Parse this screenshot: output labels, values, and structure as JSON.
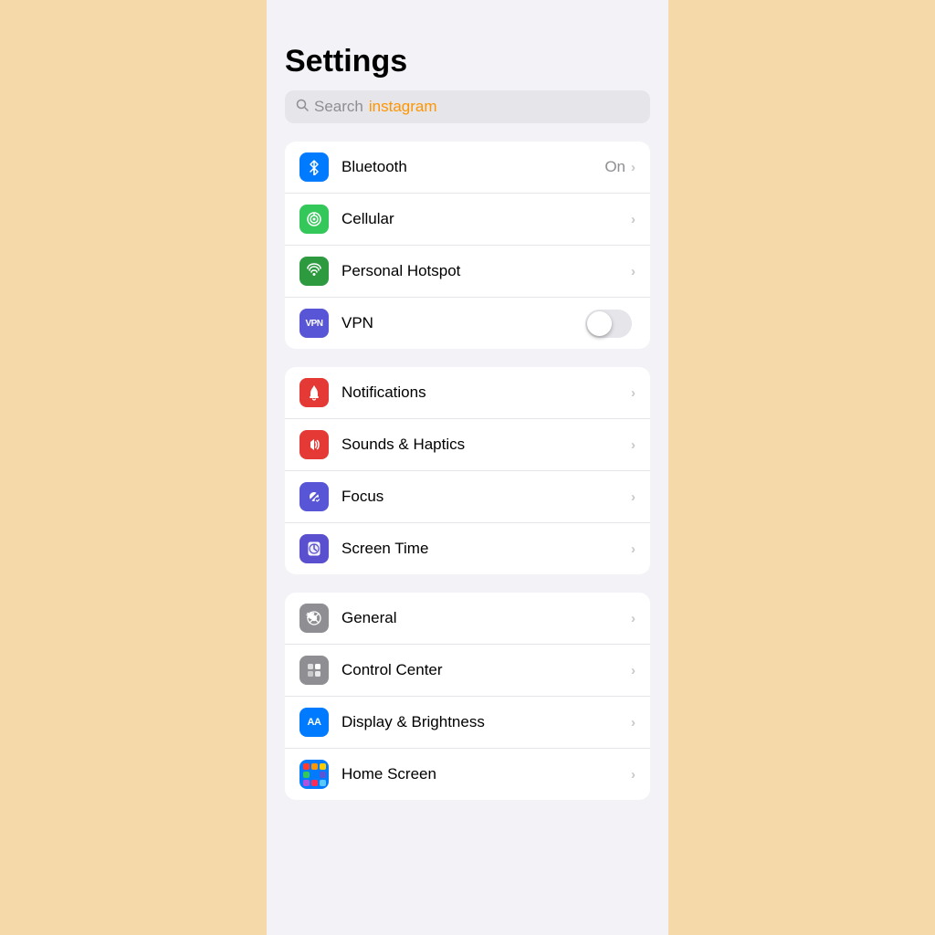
{
  "page": {
    "title": "Settings",
    "background": "#f5d9a8"
  },
  "search": {
    "placeholder": "Search",
    "query": "instagram"
  },
  "groups": [
    {
      "id": "connectivity",
      "items": [
        {
          "id": "bluetooth",
          "label": "Bluetooth",
          "value": "On",
          "icon": "bluetooth",
          "iconBg": "blue",
          "hasChevron": true,
          "hasToggle": false
        },
        {
          "id": "cellular",
          "label": "Cellular",
          "value": "",
          "icon": "cellular",
          "iconBg": "green",
          "hasChevron": true,
          "hasToggle": false
        },
        {
          "id": "personal-hotspot",
          "label": "Personal Hotspot",
          "value": "",
          "icon": "hotspot",
          "iconBg": "dark-green",
          "hasChevron": true,
          "hasToggle": false
        },
        {
          "id": "vpn",
          "label": "VPN",
          "value": "",
          "icon": "vpn",
          "iconBg": "vpn",
          "hasChevron": false,
          "hasToggle": true
        }
      ]
    },
    {
      "id": "notifications",
      "items": [
        {
          "id": "notifications",
          "label": "Notifications",
          "value": "",
          "icon": "notifications",
          "iconBg": "red",
          "hasChevron": true,
          "hasToggle": false
        },
        {
          "id": "sounds-haptics",
          "label": "Sounds & Haptics",
          "value": "",
          "icon": "sounds",
          "iconBg": "red-sound",
          "hasChevron": true,
          "hasToggle": false
        },
        {
          "id": "focus",
          "label": "Focus",
          "value": "",
          "icon": "focus",
          "iconBg": "purple",
          "hasChevron": true,
          "hasToggle": false
        },
        {
          "id": "screen-time",
          "label": "Screen Time",
          "value": "",
          "icon": "screen-time",
          "iconBg": "indigo",
          "hasChevron": true,
          "hasToggle": false
        }
      ]
    },
    {
      "id": "general",
      "items": [
        {
          "id": "general",
          "label": "General",
          "value": "",
          "icon": "general",
          "iconBg": "gray",
          "hasChevron": true,
          "hasToggle": false
        },
        {
          "id": "control-center",
          "label": "Control Center",
          "value": "",
          "icon": "control-center",
          "iconBg": "gray2",
          "hasChevron": true,
          "hasToggle": false
        },
        {
          "id": "display-brightness",
          "label": "Display & Brightness",
          "value": "",
          "icon": "display",
          "iconBg": "blue-aa",
          "hasChevron": true,
          "hasToggle": false
        },
        {
          "id": "home-screen",
          "label": "Home Screen",
          "value": "",
          "icon": "home-screen",
          "iconBg": "colorful",
          "hasChevron": true,
          "hasToggle": false
        }
      ]
    }
  ]
}
